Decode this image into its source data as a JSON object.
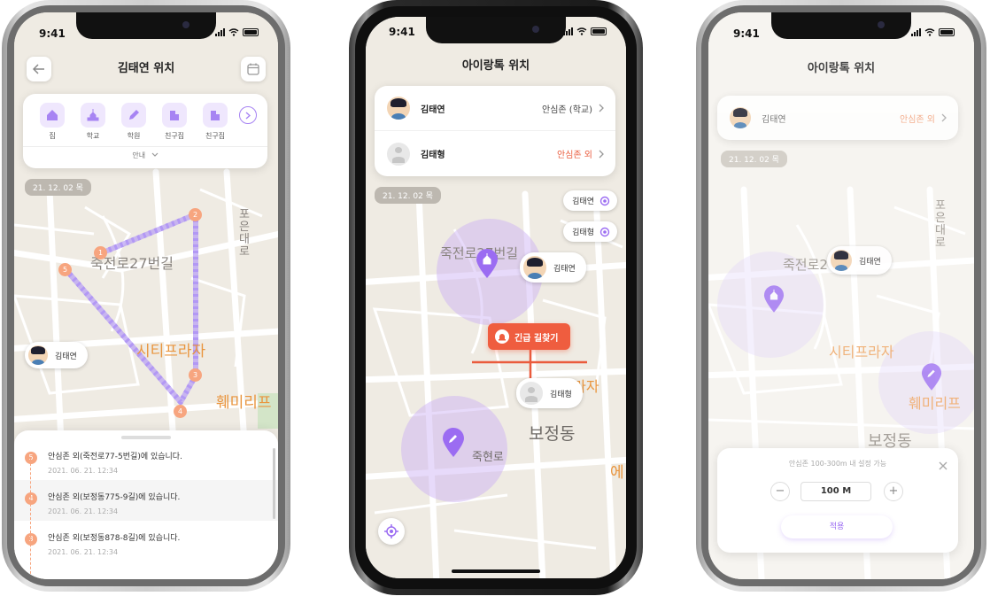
{
  "status_time": "9:41",
  "screen1": {
    "title": "김태연 위치",
    "categories": [
      {
        "label": "집",
        "icon": "home-icon"
      },
      {
        "label": "학교",
        "icon": "school-icon"
      },
      {
        "label": "학원",
        "icon": "academy-icon"
      },
      {
        "label": "친구집",
        "icon": "friend-house-icon"
      },
      {
        "label": "친구집",
        "icon": "friend-house-icon"
      }
    ],
    "guide_label": "안내",
    "date_chip": "21. 12. 02 목",
    "map_labels": {
      "road": "죽전로27번길",
      "plaza": "시티프라자",
      "store": "훼미리프",
      "road_vertical": "포은대로"
    },
    "avatar_name": "김태연",
    "route_points": [
      "1",
      "2",
      "3",
      "4",
      "5"
    ],
    "history": [
      {
        "num": "5",
        "text": "안심존 외(죽전로77-5번길)에 있습니다.",
        "time": "2021. 06. 21. 12:34"
      },
      {
        "num": "4",
        "text": "안심존 외(보정동775-9길)에 있습니다.",
        "time": "2021. 06. 21. 12:34"
      },
      {
        "num": "3",
        "text": "안심존 외(보정동878-8길)에 있습니다.",
        "time": "2021. 06. 21. 12:34"
      }
    ]
  },
  "screen2": {
    "title": "아이랑톡 위치",
    "children": [
      {
        "name": "김태연",
        "status": "안심존 (학교)",
        "alert": false
      },
      {
        "name": "김태형",
        "status": "안심존 외",
        "alert": true
      }
    ],
    "date_chip": "21. 12. 02 목",
    "side_pills": [
      "김태연",
      "김태형"
    ],
    "map_labels": {
      "road": "죽전로27번길",
      "plaza": "시티프라자",
      "dong": "보정동",
      "road2": "죽현로",
      "edge": "에"
    },
    "marker_names": [
      "김태연",
      "김태형"
    ],
    "emergency_button": "긴급 길찾기",
    "colors": {
      "accent": "#9b6cf2",
      "alert": "#ea5b3c",
      "emergency": "#ef5d3f"
    }
  },
  "screen3": {
    "title": "아이랑톡 위치",
    "child": {
      "name": "김태연",
      "status": "안심존 외"
    },
    "date_chip": "21. 12. 02 목",
    "map_labels": {
      "road": "죽전로2",
      "plaza": "시티프라자",
      "store": "훼미리프",
      "dong": "보정동",
      "road_vertical": "포은대로"
    },
    "marker_name": "김태연",
    "sheet": {
      "hint": "안심존 100-300m 내 설정 가능",
      "value": "100 M",
      "minus": "−",
      "plus": "+",
      "apply_label": "적용"
    }
  }
}
